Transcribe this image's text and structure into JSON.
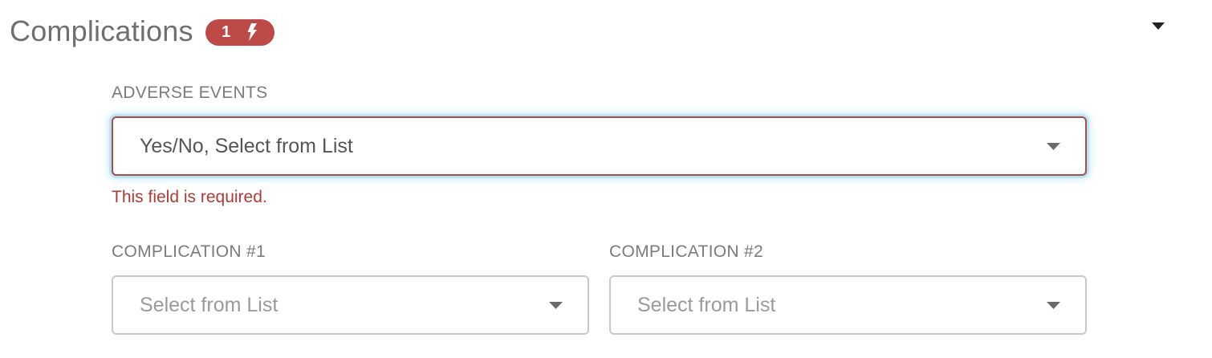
{
  "section": {
    "title": "Complications",
    "badge_count": "1",
    "badge_icon": "lightning-icon",
    "toggle_icon": "caret-down-icon"
  },
  "adverse_events": {
    "label": "ADVERSE EVENTS",
    "value": "Yes/No, Select from List",
    "error": "This field is required."
  },
  "complication_1": {
    "label": "COMPLICATION #1",
    "placeholder": "Select from List"
  },
  "complication_2": {
    "label": "COMPLICATION #2",
    "placeholder": "Select from List"
  },
  "colors": {
    "badge": "#bd4a46",
    "error": "#b03a36",
    "focus_glow": "#7fd0f0",
    "border": "#c9c9c9"
  }
}
